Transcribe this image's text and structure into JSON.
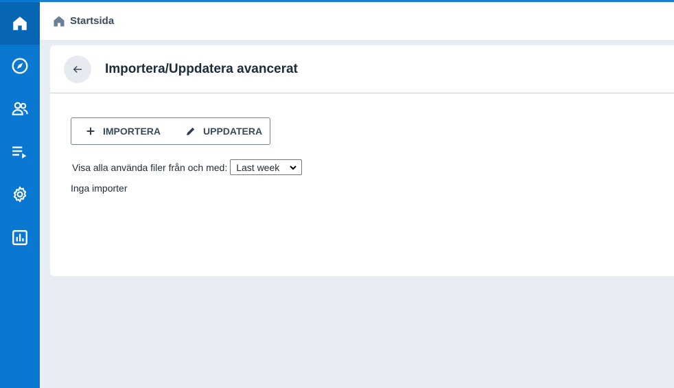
{
  "header": {
    "breadcrumb": "Startsida"
  },
  "sidebar": {
    "items": [
      {
        "icon": "home-icon"
      },
      {
        "icon": "compass-icon"
      },
      {
        "icon": "users-icon"
      },
      {
        "icon": "playlist-icon"
      },
      {
        "icon": "gear-icon"
      },
      {
        "icon": "report-icon"
      }
    ]
  },
  "page": {
    "title": "Importera/Uppdatera avancerat",
    "actions": {
      "import_label": "IMPORTERA",
      "update_label": "UPPDATERA"
    },
    "filter": {
      "label": "Visa alla använda filer från och med:",
      "selected": "Last week"
    },
    "empty_text": "Inga importer"
  },
  "colors": {
    "sidebar": "#0a78d0",
    "background": "#e8edf3",
    "card": "#ffffff"
  }
}
